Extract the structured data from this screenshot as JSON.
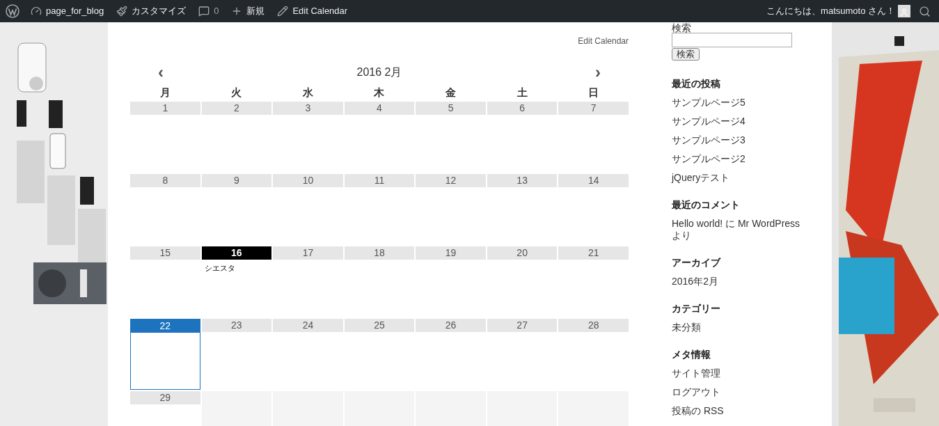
{
  "admin_bar": {
    "items": [
      {
        "kind": "site",
        "label": "page_for_blog"
      },
      {
        "kind": "customize",
        "label": "カスタマイズ"
      },
      {
        "kind": "comments",
        "label": "0"
      },
      {
        "kind": "new",
        "label": "新規"
      },
      {
        "kind": "edit",
        "label": "Edit Calendar"
      }
    ],
    "greeting": "こんにちは、matsumoto さん！"
  },
  "calendar": {
    "edit_link": "Edit Calendar",
    "prev": "‹",
    "next": "›",
    "month": "2016 2月",
    "weekdays": [
      "月",
      "火",
      "水",
      "木",
      "金",
      "土",
      "日"
    ],
    "weeks": [
      [
        {
          "day": "1",
          "selected": false,
          "highlighted": false
        },
        {
          "day": "2",
          "selected": false,
          "highlighted": false
        },
        {
          "day": "3",
          "selected": false,
          "highlighted": false
        },
        {
          "day": "4",
          "selected": false,
          "highlighted": false
        },
        {
          "day": "5",
          "selected": false,
          "highlighted": false
        },
        {
          "day": "6",
          "selected": false,
          "highlighted": false
        },
        {
          "day": "7",
          "selected": false,
          "highlighted": false
        }
      ],
      [
        {
          "day": "8",
          "selected": false,
          "highlighted": false
        },
        {
          "day": "9",
          "selected": false,
          "highlighted": false
        },
        {
          "day": "10",
          "selected": false,
          "highlighted": false
        },
        {
          "day": "11",
          "selected": false,
          "highlighted": false
        },
        {
          "day": "12",
          "selected": false,
          "highlighted": false
        },
        {
          "day": "13",
          "selected": false,
          "highlighted": false
        },
        {
          "day": "14",
          "selected": false,
          "highlighted": false
        }
      ],
      [
        {
          "day": "15",
          "selected": false,
          "highlighted": false
        },
        {
          "day": "16",
          "selected": false,
          "highlighted": true,
          "events": [
            "シエスタ"
          ]
        },
        {
          "day": "17",
          "selected": false,
          "highlighted": false
        },
        {
          "day": "18",
          "selected": false,
          "highlighted": false
        },
        {
          "day": "19",
          "selected": false,
          "highlighted": false
        },
        {
          "day": "20",
          "selected": false,
          "highlighted": false
        },
        {
          "day": "21",
          "selected": false,
          "highlighted": false
        }
      ],
      [
        {
          "day": "22",
          "selected": true,
          "highlighted": false
        },
        {
          "day": "23",
          "selected": false,
          "highlighted": false
        },
        {
          "day": "24",
          "selected": false,
          "highlighted": false
        },
        {
          "day": "25",
          "selected": false,
          "highlighted": false
        },
        {
          "day": "26",
          "selected": false,
          "highlighted": false
        },
        {
          "day": "27",
          "selected": false,
          "highlighted": false
        },
        {
          "day": "28",
          "selected": false,
          "highlighted": false
        }
      ],
      [
        {
          "day": "29",
          "selected": false,
          "highlighted": false
        }
      ]
    ]
  },
  "sidebar": {
    "search": {
      "label": "検索",
      "button": "検索"
    },
    "sections": [
      {
        "title": "最近の投稿",
        "links": [
          "サンプルページ5",
          "サンプルページ4",
          "サンプルページ3",
          "サンプルページ2",
          "jQueryテスト"
        ]
      },
      {
        "title": "最近のコメント",
        "links": [
          "Hello world! に Mr WordPress より"
        ]
      },
      {
        "title": "アーカイブ",
        "links": [
          "2016年2月"
        ]
      },
      {
        "title": "カテゴリー",
        "links": [
          "未分類"
        ]
      },
      {
        "title": "メタ情報",
        "links": [
          "サイト管理",
          "ログアウト",
          "投稿の RSS"
        ]
      }
    ]
  }
}
